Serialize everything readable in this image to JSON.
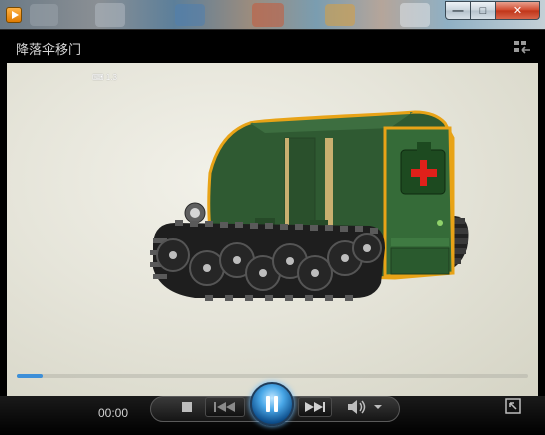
{
  "window": {
    "minimize_glyph": "—",
    "maximize_glyph": "□",
    "close_glyph": "✕"
  },
  "player": {
    "title": "降落伞移门",
    "current_time": "00:00",
    "progress": 0.05,
    "watermark": "⌨ 1.3"
  },
  "colors": {
    "accent": "#3d8fd8",
    "vehicle_body": "#2f5a32",
    "trim": "#e8a317",
    "cross": "#e0201a"
  },
  "icons": {
    "app": "media-player-icon",
    "switch_view": "switch-to-library-icon",
    "stop": "stop-icon",
    "prev": "previous-icon",
    "play_pause": "pause-icon",
    "next": "next-icon",
    "volume": "volume-icon",
    "fullscreen": "fullscreen-icon"
  }
}
